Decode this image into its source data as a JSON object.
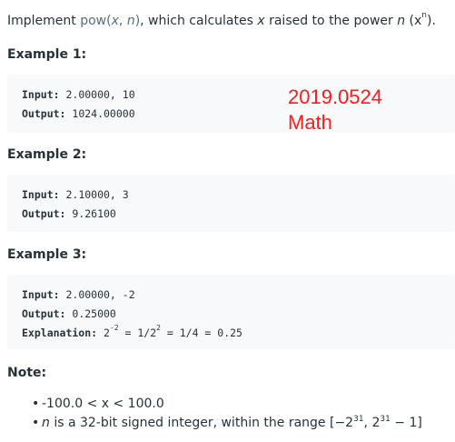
{
  "intro": {
    "prefix": "Implement ",
    "fn_name": "pow(",
    "fn_x": "x",
    "fn_sep": ", ",
    "fn_n": "n",
    "fn_close": ")",
    "middle": ", which calculates ",
    "var_x": "x",
    "raised": " raised to the power ",
    "var_n": "n",
    "paren_open": " (x",
    "exp": "n",
    "paren_close": ")."
  },
  "examples": [
    {
      "heading": "Example 1:",
      "input_label": "Input:",
      "input_value": " 2.00000, 10",
      "output_label": "Output:",
      "output_value": " 1024.00000"
    },
    {
      "heading": "Example 2:",
      "input_label": "Input:",
      "input_value": " 2.10000, 3",
      "output_label": "Output:",
      "output_value": " 9.26100"
    },
    {
      "heading": "Example 3:",
      "input_label": "Input:",
      "input_value": " 2.00000, -2",
      "output_label": "Output:",
      "output_value": " 0.25000",
      "explanation_label": "Explanation:",
      "explanation_pre": " 2",
      "explanation_exp1": "-2",
      "explanation_mid": " = 1/2",
      "explanation_exp2": "2",
      "explanation_post": " = 1/4 = 0.25"
    }
  ],
  "stamp": {
    "date": "2019.0524",
    "tag": "Math"
  },
  "note": {
    "heading": "Note:",
    "bullet": "•",
    "item1": "-100.0 < x < 100.0",
    "item2_var": "n",
    "item2_text": " is a 32-bit signed integer, within the range [−2",
    "item2_exp1": "31",
    "item2_mid": ", 2",
    "item2_exp2": "31",
    "item2_end": " − 1]"
  }
}
